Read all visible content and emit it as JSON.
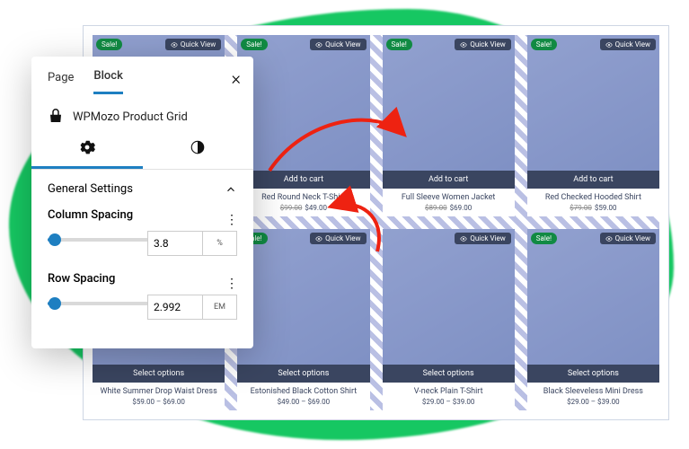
{
  "panel": {
    "tabs": {
      "page": "Page",
      "block": "Block"
    },
    "block_name": "WPMozo Product Grid",
    "section_title": "General Settings",
    "column_spacing": {
      "label": "Column Spacing",
      "value": "3.8",
      "unit": "%"
    },
    "row_spacing": {
      "label": "Row Spacing",
      "value": "2.992",
      "unit": "EM"
    }
  },
  "quick_view": "Quick View",
  "sale_badge": "Sale!",
  "row1_cta": "Add to cart",
  "row2_cta": "Select options",
  "products": [
    {
      "name": "",
      "price": ""
    },
    {
      "name": "Red Round Neck T-Shirt",
      "price": "$49.00",
      "old": "$99.00"
    },
    {
      "name": "Full Sleeve Women Jacket",
      "price": "$69.00",
      "old": "$89.00"
    },
    {
      "name": "Red Checked Hooded Shirt",
      "price": "$59.00",
      "old": "$79.00"
    },
    {
      "name": "White Summer Drop Waist Dress",
      "price": "$59.00 – $69.00"
    },
    {
      "name": "Estonished Black Cotton Shirt",
      "price": "$49.00 – $69.00"
    },
    {
      "name": "V-neck Plain T-Shirt",
      "price": "$29.00 – $39.00"
    },
    {
      "name": "Black Sleeveless Mini Dress",
      "price": "$29.00 – $39.00"
    }
  ]
}
